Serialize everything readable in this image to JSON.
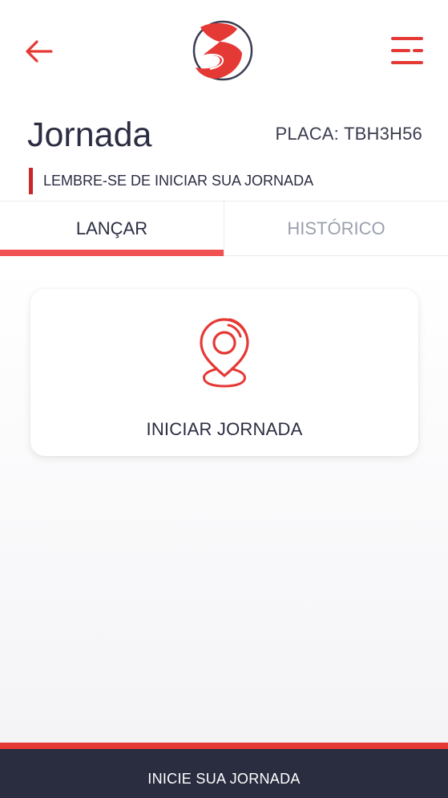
{
  "header": {
    "back_icon": "arrow-left-icon",
    "logo": "brand-logo",
    "menu_icon": "menu-icon",
    "accent_color": "#e53935"
  },
  "page": {
    "title": "Jornada",
    "plate_label": "PLACA:",
    "plate_value": "TBH3H56",
    "reminder": "LEMBRE-SE DE INICIAR SUA JORNADA"
  },
  "tabs": [
    {
      "label": "LANÇAR",
      "active": true
    },
    {
      "label": "HISTÓRICO",
      "active": false
    }
  ],
  "card": {
    "icon": "location-pin-icon",
    "label": "INICIAR JORNADA"
  },
  "footer": {
    "label": "INICIE SUA JORNADA",
    "background": "#2a2d40"
  }
}
